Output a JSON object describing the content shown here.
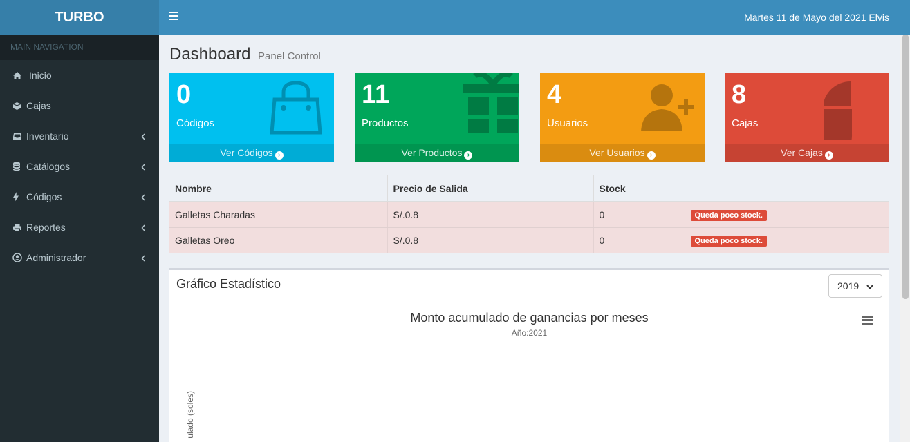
{
  "app": {
    "logo": "TURBO"
  },
  "sidebar": {
    "header": "MAIN NAVIGATION",
    "items": [
      {
        "label": "Inicio",
        "icon": "home-icon"
      },
      {
        "label": "Cajas",
        "icon": "cube-icon"
      },
      {
        "label": "Inventario",
        "icon": "inbox-icon"
      },
      {
        "label": "Catálogos",
        "icon": "database-icon"
      },
      {
        "label": "Códigos",
        "icon": "bolt-icon"
      },
      {
        "label": "Reportes",
        "icon": "print-icon"
      },
      {
        "label": "Administrador",
        "icon": "user-circle-icon"
      }
    ]
  },
  "header": {
    "date_user": "Martes 11 de Mayo del 2021 Elvis"
  },
  "page": {
    "title": "Dashboard",
    "subtitle": "Panel Control"
  },
  "stats": [
    {
      "value": "0",
      "label": "Códigos",
      "link": "Ver Códigos",
      "color": "#00c0ef",
      "icon": "shopping-bag-icon"
    },
    {
      "value": "11",
      "label": "Productos",
      "link": "Ver Productos",
      "color": "#00a65a",
      "icon": "gift-icon"
    },
    {
      "value": "4",
      "label": "Usuarios",
      "link": "Ver Usuarios",
      "color": "#f39c12",
      "icon": "user-plus-icon"
    },
    {
      "value": "8",
      "label": "Cajas",
      "link": "Ver Cajas",
      "color": "#dd4b39",
      "icon": "pie-chart-icon"
    }
  ],
  "stock_table": {
    "headers": [
      "Nombre",
      "Precio de Salida",
      "Stock"
    ],
    "rows": [
      {
        "name": "Galletas Charadas",
        "price": "S/.0.8",
        "stock": "0",
        "badge": "Queda poco stock."
      },
      {
        "name": "Galletas Oreo",
        "price": "S/.0.8",
        "stock": "0",
        "badge": "Queda poco stock."
      }
    ]
  },
  "chart_box": {
    "title": "Gráfico Estadístico",
    "year_selected": "2019"
  },
  "chart_data": {
    "type": "line",
    "title": "Monto acumulado de ganancias por meses",
    "subtitle": "Año:2021",
    "ylabel": "ulado (soles)"
  }
}
